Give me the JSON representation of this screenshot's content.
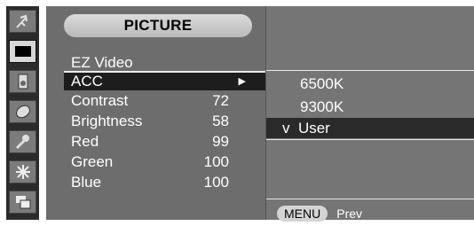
{
  "title": "PICTURE",
  "menu": [
    {
      "label": "EZ Video",
      "value": ""
    },
    {
      "label": "ACC",
      "value": "",
      "arrow": "▶",
      "selected": true
    },
    {
      "label": "Contrast",
      "value": "72"
    },
    {
      "label": "Brightness",
      "value": "58"
    },
    {
      "label": "Red",
      "value": "99"
    },
    {
      "label": "Green",
      "value": "100"
    },
    {
      "label": "Blue",
      "value": "100"
    }
  ],
  "submenu": [
    {
      "label": "6500K"
    },
    {
      "label": "9300K"
    },
    {
      "label": "v  User",
      "selected": true
    }
  ],
  "footer": {
    "menu_label": "MENU",
    "prev_label": "Prev"
  },
  "rail_icons": [
    "antenna-icon",
    "picture-icon",
    "speaker-icon",
    "time-icon",
    "key-lock-icon",
    "special-icon",
    "screen-icon"
  ],
  "colors": {
    "panel": "#6d6d6d",
    "selected": "#1d1d1d",
    "title_pill": "#cfcfcf"
  }
}
